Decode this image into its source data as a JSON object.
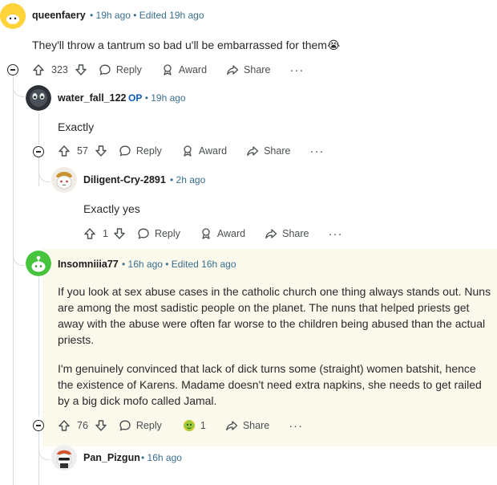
{
  "comments": [
    {
      "author": "queenfaery",
      "meta": "• 19h ago • Edited 19h ago",
      "body": "They'll throw a tantrum so bad u'll be embarrassed for them😭",
      "votes": "323",
      "reply": "Reply",
      "award": "Award",
      "share": "Share",
      "more": "···"
    },
    {
      "author": "water_fall_122",
      "op_badge": "OP",
      "meta": "• 19h ago",
      "body": "Exactly",
      "votes": "57",
      "reply": "Reply",
      "award": "Award",
      "share": "Share",
      "more": "···"
    },
    {
      "author": "Diligent-Cry-2891",
      "meta": "• 2h ago",
      "body": "Exactly yes",
      "votes": "1",
      "reply": "Reply",
      "award": "Award",
      "share": "Share",
      "more": "···"
    },
    {
      "author": "Insomniiia77",
      "meta": "• 16h ago • Edited 16h ago",
      "body_p1": "If you look at sex abuse cases in the catholic church one thing always stands out. Nuns are among the most sadistic people on the planet. The nuns that helped priests get away with the abuse were often far worse to the children being abused than the actual priests.",
      "body_p2": "I'm genuinely convinced that lack of dick turns some (straight) women batshit, hence the existence of Karens. Madame doesn't need extra napkins, she needs to get railed by a big dick mofo called Jamal.",
      "votes": "76",
      "reply": "Reply",
      "award_count": "1",
      "share": "Share",
      "more": "···"
    },
    {
      "author": "Pan_Pizgun",
      "meta": "• 16h ago"
    }
  ],
  "colors": {
    "highlight_bg": "#fbf8ec",
    "meta": "#3a6f8f",
    "op": "#0a5ac2"
  }
}
